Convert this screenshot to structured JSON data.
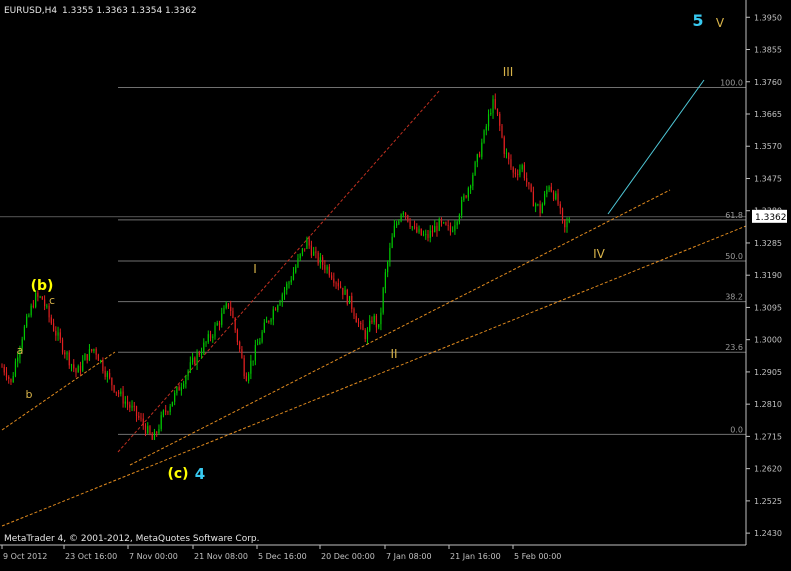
{
  "header": {
    "symbol_label": "EURUSD,H4",
    "ohlc_label": "1.3355 1.3363 1.3354 1.3362"
  },
  "footer": {
    "copyright": "MetaTrader 4, © 2001-2012, MetaQuotes Software Corp."
  },
  "current_price_label": "1.3362",
  "chart_data": {
    "type": "candlestick",
    "title": "EURUSD,H4",
    "ylim": [
      1.2395,
      1.3995
    ],
    "ticks": [
      "1.3950",
      "1.3855",
      "1.3760",
      "1.3665",
      "1.3570",
      "1.3475",
      "1.3380",
      "1.3285",
      "1.3190",
      "1.3095",
      "1.3000",
      "1.2905",
      "1.2810",
      "1.2715",
      "1.2620",
      "1.2525",
      "1.2430"
    ],
    "x_labels": [
      "9 Oct 2012",
      "23 Oct 16:00",
      "7 Nov 00:00",
      "21 Nov 08:00",
      "5 Dec 16:00",
      "20 Dec 00:00",
      "7 Jan 08:00",
      "21 Jan 16:00",
      "5 Feb 00:00"
    ],
    "current_price": 1.3362,
    "fibonacci": {
      "levels": [
        {
          "label": "100.0",
          "price": 1.3743
        },
        {
          "label": "61.8",
          "price": 1.3353
        },
        {
          "label": "50.0",
          "price": 1.3232
        },
        {
          "label": "38.2",
          "price": 1.3112
        },
        {
          "label": "23.6",
          "price": 1.2963
        },
        {
          "label": "0.0",
          "price": 1.2721
        }
      ]
    },
    "wave_labels": [
      {
        "text": "(b)",
        "color": "#ffff00",
        "kind": "primary"
      },
      {
        "text": "c",
        "color": "#d9b44a",
        "kind": "minor"
      },
      {
        "text": "a",
        "color": "#d9b44a",
        "kind": "minor"
      },
      {
        "text": "b",
        "color": "#d9b44a",
        "kind": "minor"
      },
      {
        "text": "(c)",
        "color": "#ffff00",
        "kind": "primary"
      },
      {
        "text": "4",
        "color": "#38c9f0",
        "kind": "primary"
      },
      {
        "text": "I",
        "color": "#d9b44a",
        "kind": "minor"
      },
      {
        "text": "II",
        "color": "#d9b44a",
        "kind": "minor"
      },
      {
        "text": "III",
        "color": "#d9b44a",
        "kind": "minor"
      },
      {
        "text": "IV",
        "color": "#d9b44a",
        "kind": "minor"
      },
      {
        "text": "5",
        "color": "#38c9f0",
        "kind": "primary"
      },
      {
        "text": "V",
        "color": "#d9b44a",
        "kind": "minor"
      }
    ],
    "colors": {
      "background": "#000000",
      "axis": "#c0c0c0",
      "bull_candle": "#00c800",
      "bear_candle": "#e02020",
      "fib_line": "#707070",
      "trend_channel_red": "#c03020",
      "trend_orange": "#e08a1e",
      "projection": "#4fc8d8",
      "price_label_bg": "#ffffff"
    },
    "path_points": [
      {
        "t": 0,
        "p": 1.292
      },
      {
        "t": 3,
        "p": 1.2905
      },
      {
        "t": 6,
        "p": 1.287
      },
      {
        "t": 10,
        "p": 1.2955
      },
      {
        "t": 14,
        "p": 1.302
      },
      {
        "t": 18,
        "p": 1.307
      },
      {
        "t": 22,
        "p": 1.3125
      },
      {
        "t": 27,
        "p": 1.312
      },
      {
        "t": 32,
        "p": 1.306
      },
      {
        "t": 38,
        "p": 1.3
      },
      {
        "t": 44,
        "p": 1.295
      },
      {
        "t": 50,
        "p": 1.29
      },
      {
        "t": 56,
        "p": 1.295
      },
      {
        "t": 62,
        "p": 1.2975
      },
      {
        "t": 66,
        "p": 1.2935
      },
      {
        "t": 72,
        "p": 1.288
      },
      {
        "t": 80,
        "p": 1.283
      },
      {
        "t": 88,
        "p": 1.279
      },
      {
        "t": 96,
        "p": 1.274
      },
      {
        "t": 101,
        "p": 1.27
      },
      {
        "t": 104,
        "p": 1.2735
      },
      {
        "t": 108,
        "p": 1.278
      },
      {
        "t": 115,
        "p": 1.283
      },
      {
        "t": 122,
        "p": 1.289
      },
      {
        "t": 130,
        "p": 1.295
      },
      {
        "t": 138,
        "p": 1.3
      },
      {
        "t": 146,
        "p": 1.306
      },
      {
        "t": 152,
        "p": 1.311
      },
      {
        "t": 158,
        "p": 1.299
      },
      {
        "t": 163,
        "p": 1.289
      },
      {
        "t": 168,
        "p": 1.295
      },
      {
        "t": 176,
        "p": 1.304
      },
      {
        "t": 184,
        "p": 1.311
      },
      {
        "t": 192,
        "p": 1.317
      },
      {
        "t": 199,
        "p": 1.324
      },
      {
        "t": 204,
        "p": 1.329
      },
      {
        "t": 210,
        "p": 1.324
      },
      {
        "t": 218,
        "p": 1.321
      },
      {
        "t": 226,
        "p": 1.316
      },
      {
        "t": 234,
        "p": 1.31
      },
      {
        "t": 240,
        "p": 1.303
      },
      {
        "t": 244,
        "p": 1.301
      },
      {
        "t": 248,
        "p": 1.307
      },
      {
        "t": 252,
        "p": 1.303
      },
      {
        "t": 256,
        "p": 1.318
      },
      {
        "t": 262,
        "p": 1.332
      },
      {
        "t": 268,
        "p": 1.339
      },
      {
        "t": 276,
        "p": 1.332
      },
      {
        "t": 284,
        "p": 1.33
      },
      {
        "t": 292,
        "p": 1.334
      },
      {
        "t": 300,
        "p": 1.332
      },
      {
        "t": 306,
        "p": 1.338
      },
      {
        "t": 312,
        "p": 1.345
      },
      {
        "t": 318,
        "p": 1.353
      },
      {
        "t": 323,
        "p": 1.361
      },
      {
        "t": 328,
        "p": 1.37
      },
      {
        "t": 332,
        "p": 1.365
      },
      {
        "t": 336,
        "p": 1.356
      },
      {
        "t": 342,
        "p": 1.349
      },
      {
        "t": 348,
        "p": 1.351
      },
      {
        "t": 354,
        "p": 1.342
      },
      {
        "t": 360,
        "p": 1.338
      },
      {
        "t": 366,
        "p": 1.346
      },
      {
        "t": 372,
        "p": 1.34
      },
      {
        "t": 376,
        "p": 1.332
      },
      {
        "t": 380,
        "p": 1.3362
      }
    ]
  }
}
